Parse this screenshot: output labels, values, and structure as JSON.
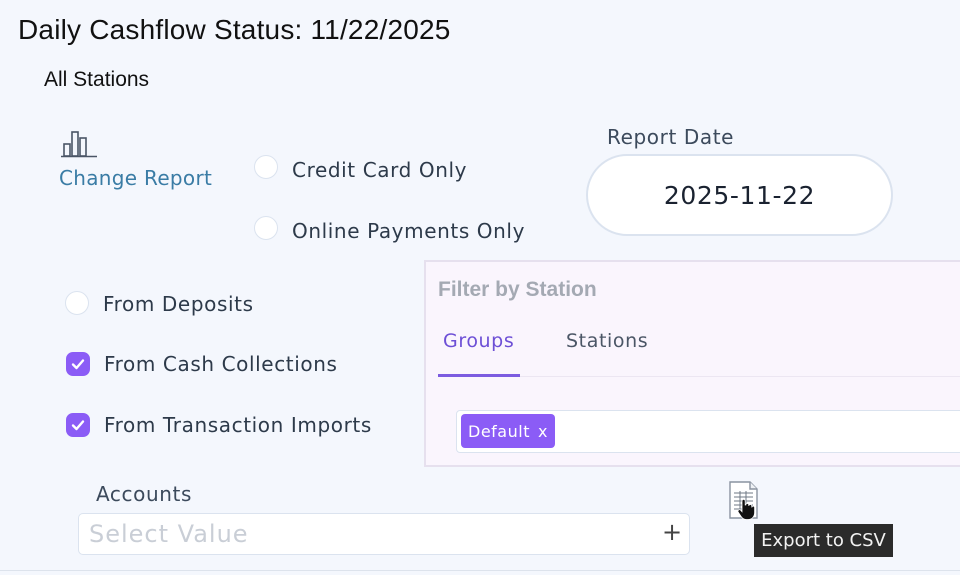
{
  "header": {
    "title": "Daily Cashflow Status: 11/22/2025",
    "subtitle": "All Stations"
  },
  "change_report": {
    "label": "Change Report",
    "icon": "bar-chart-icon"
  },
  "options": {
    "credit_card_only": {
      "label": "Credit Card Only",
      "checked": false
    },
    "online_payments_only": {
      "label": "Online Payments Only",
      "checked": false
    },
    "from_deposits": {
      "label": "From Deposits",
      "checked": false
    },
    "from_cash_collections": {
      "label": "From Cash Collections",
      "checked": true
    },
    "from_transaction_imports": {
      "label": "From Transaction Imports",
      "checked": true
    }
  },
  "report_date": {
    "label": "Report Date",
    "value": "2025-11-22"
  },
  "filter": {
    "title": "Filter by Station",
    "tabs": [
      {
        "label": "Groups",
        "active": true
      },
      {
        "label": "Stations",
        "active": false
      }
    ],
    "tags": [
      {
        "label": "Default",
        "remove": "x"
      }
    ]
  },
  "accounts": {
    "label": "Accounts",
    "placeholder": "Select Value",
    "add": "+"
  },
  "export": {
    "tooltip": "Export to CSV",
    "icon": "csv-file-icon"
  },
  "colors": {
    "accent": "#8b5cf6",
    "link": "#3a7ca5",
    "background": "#f4f7fd"
  }
}
